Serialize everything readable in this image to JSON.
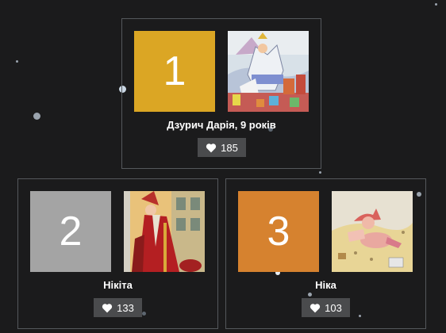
{
  "colors": {
    "background": "#1b1b1c",
    "card_border": "#55585c",
    "rank_1": "#dba624",
    "rank_2": "#a4a4a4",
    "rank_3": "#d6822f",
    "like_button": "#4a4b4d"
  },
  "entries": [
    {
      "rank": "1",
      "name": "Дзурич Дарія, 9 років",
      "likes": "185",
      "art": "knight-painting"
    },
    {
      "rank": "2",
      "name": "Нікіта",
      "likes": "133",
      "art": "red-saint-painting"
    },
    {
      "rank": "3",
      "name": "Ніка",
      "likes": "103",
      "art": "sleeping-child-painting"
    }
  ],
  "icons": {
    "like": "heart-icon"
  }
}
